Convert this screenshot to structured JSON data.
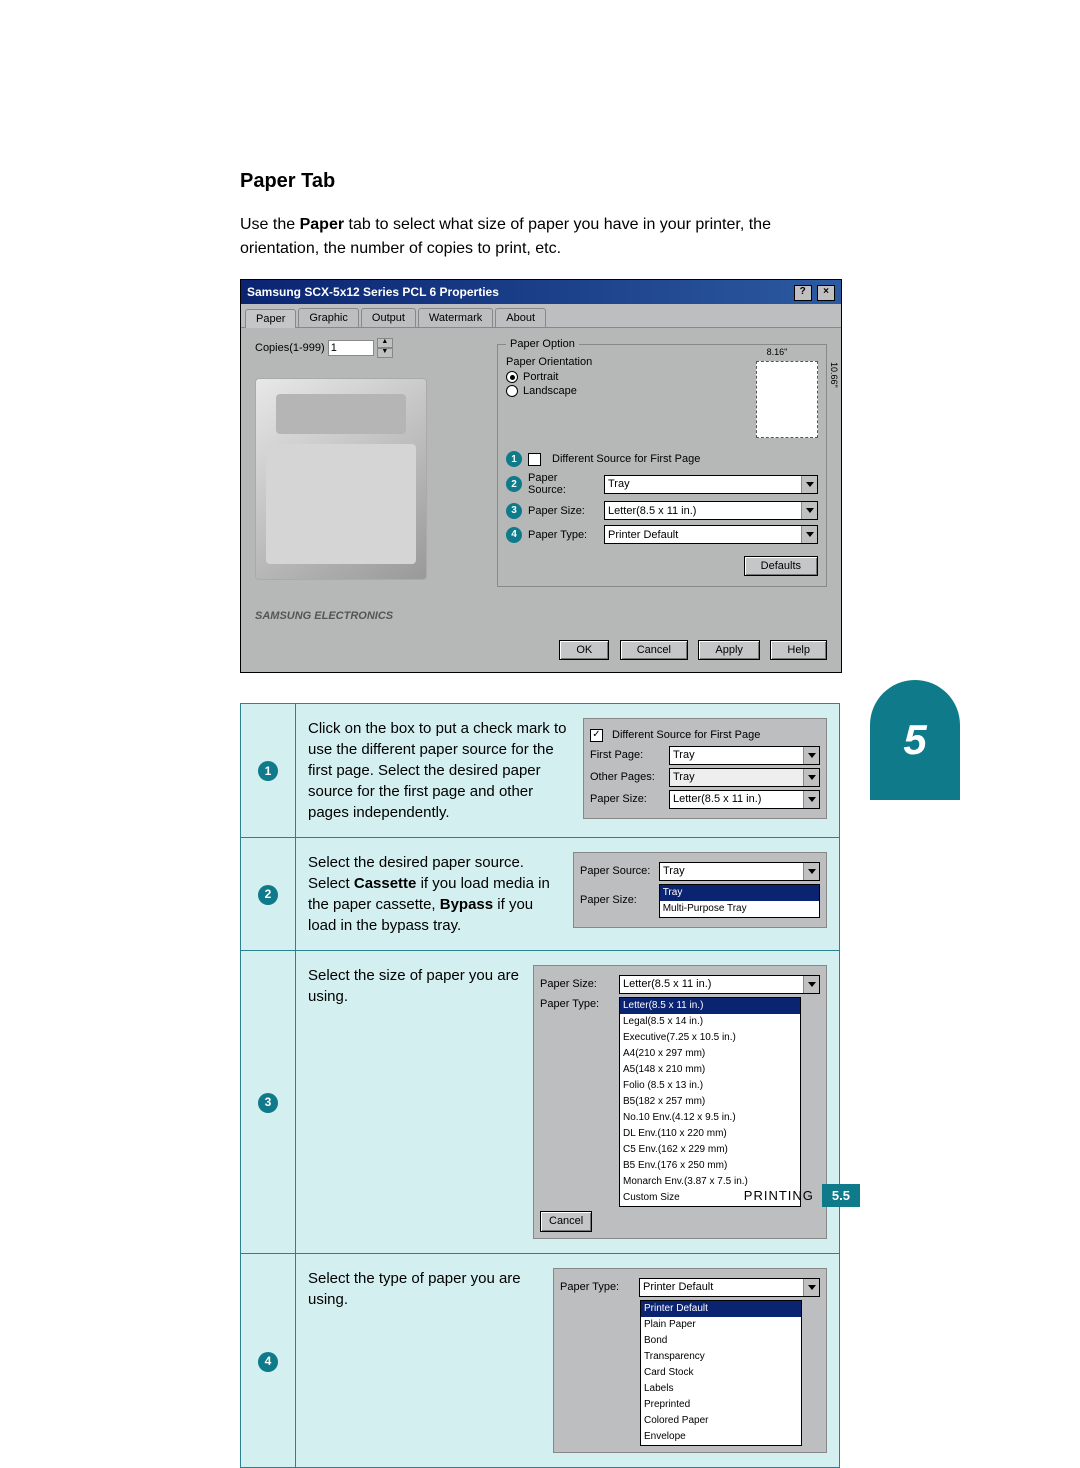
{
  "heading": "Paper Tab",
  "intro_pre": "Use the ",
  "intro_bold": "Paper",
  "intro_post": " tab to select what size of paper you have in your printer, the orientation, the number of copies to print, etc.",
  "dialog": {
    "title": "Samsung SCX-5x12 Series PCL 6 Properties",
    "tabs": [
      "Paper",
      "Graphic",
      "Output",
      "Watermark",
      "About"
    ],
    "copies_label": "Copies(1-999)",
    "copies_value": "1",
    "logo": "SAMSUNG ELECTRONICS",
    "paper_option_legend": "Paper Option",
    "orientation_label": "Paper Orientation",
    "portrait": "Portrait",
    "landscape": "Landscape",
    "preview_w": "8.16\"",
    "preview_h": "10.66\"",
    "diff_source": "Different Source for First Page",
    "paper_source_label": "Paper Source:",
    "paper_source_value": "Tray",
    "paper_size_label": "Paper Size:",
    "paper_size_value": "Letter(8.5 x 11 in.)",
    "paper_type_label": "Paper Type:",
    "paper_type_value": "Printer Default",
    "defaults_btn": "Defaults",
    "ok": "OK",
    "cancel": "Cancel",
    "apply": "Apply",
    "help": "Help"
  },
  "callouts": [
    {
      "num": "1",
      "text": "Click on the box to put a check mark to use the different paper source for the first page. Select the desired paper source for the first page and other pages independently.",
      "ui": {
        "diff_source": "Different Source for First Page",
        "first_page_label": "First Page:",
        "first_page_value": "Tray",
        "other_pages_label": "Other Pages:",
        "other_pages_value": "Tray",
        "paper_size_label": "Paper Size:",
        "paper_size_value": "Letter(8.5 x 11 in.)"
      }
    },
    {
      "num": "2",
      "text_parts": [
        "Select the desired paper source. Select ",
        "Cassette",
        " if you load media in the paper cassette, ",
        "Bypass",
        " if you load in the bypass tray."
      ],
      "ui": {
        "paper_source_label": "Paper Source:",
        "paper_source_value": "Tray",
        "paper_size_label": "Paper Size:",
        "options": [
          "Tray",
          "Multi-Purpose Tray"
        ]
      }
    },
    {
      "num": "3",
      "text": "Select the size of paper you are using.",
      "ui": {
        "paper_size_label": "Paper Size:",
        "paper_size_value": "Letter(8.5 x 11 in.)",
        "paper_type_label": "Paper Type:",
        "cancel": "Cancel",
        "options": [
          "Letter(8.5 x 11 in.)",
          "Legal(8.5 x 14 in.)",
          "Executive(7.25 x 10.5 in.)",
          "A4(210 x 297 mm)",
          "A5(148 x 210 mm)",
          "Folio (8.5 x 13 in.)",
          "B5(182 x 257 mm)",
          "No.10 Env.(4.12 x 9.5 in.)",
          "DL Env.(110 x 220 mm)",
          "C5 Env.(162 x 229 mm)",
          "B5 Env.(176 x 250 mm)",
          "Monarch Env.(3.87 x 7.5 in.)",
          "Custom Size"
        ]
      }
    },
    {
      "num": "4",
      "text": "Select the type of paper you are using.",
      "ui": {
        "paper_type_label": "Paper Type:",
        "paper_type_value": "Printer Default",
        "options": [
          "Printer Default",
          "Plain Paper",
          "Bond",
          "Transparency",
          "Card Stock",
          "Labels",
          "Preprinted",
          "Colored Paper",
          "Envelope"
        ]
      }
    }
  ],
  "side_tab": "5",
  "footer_label": "PRINTING",
  "footer_page": "5.5"
}
